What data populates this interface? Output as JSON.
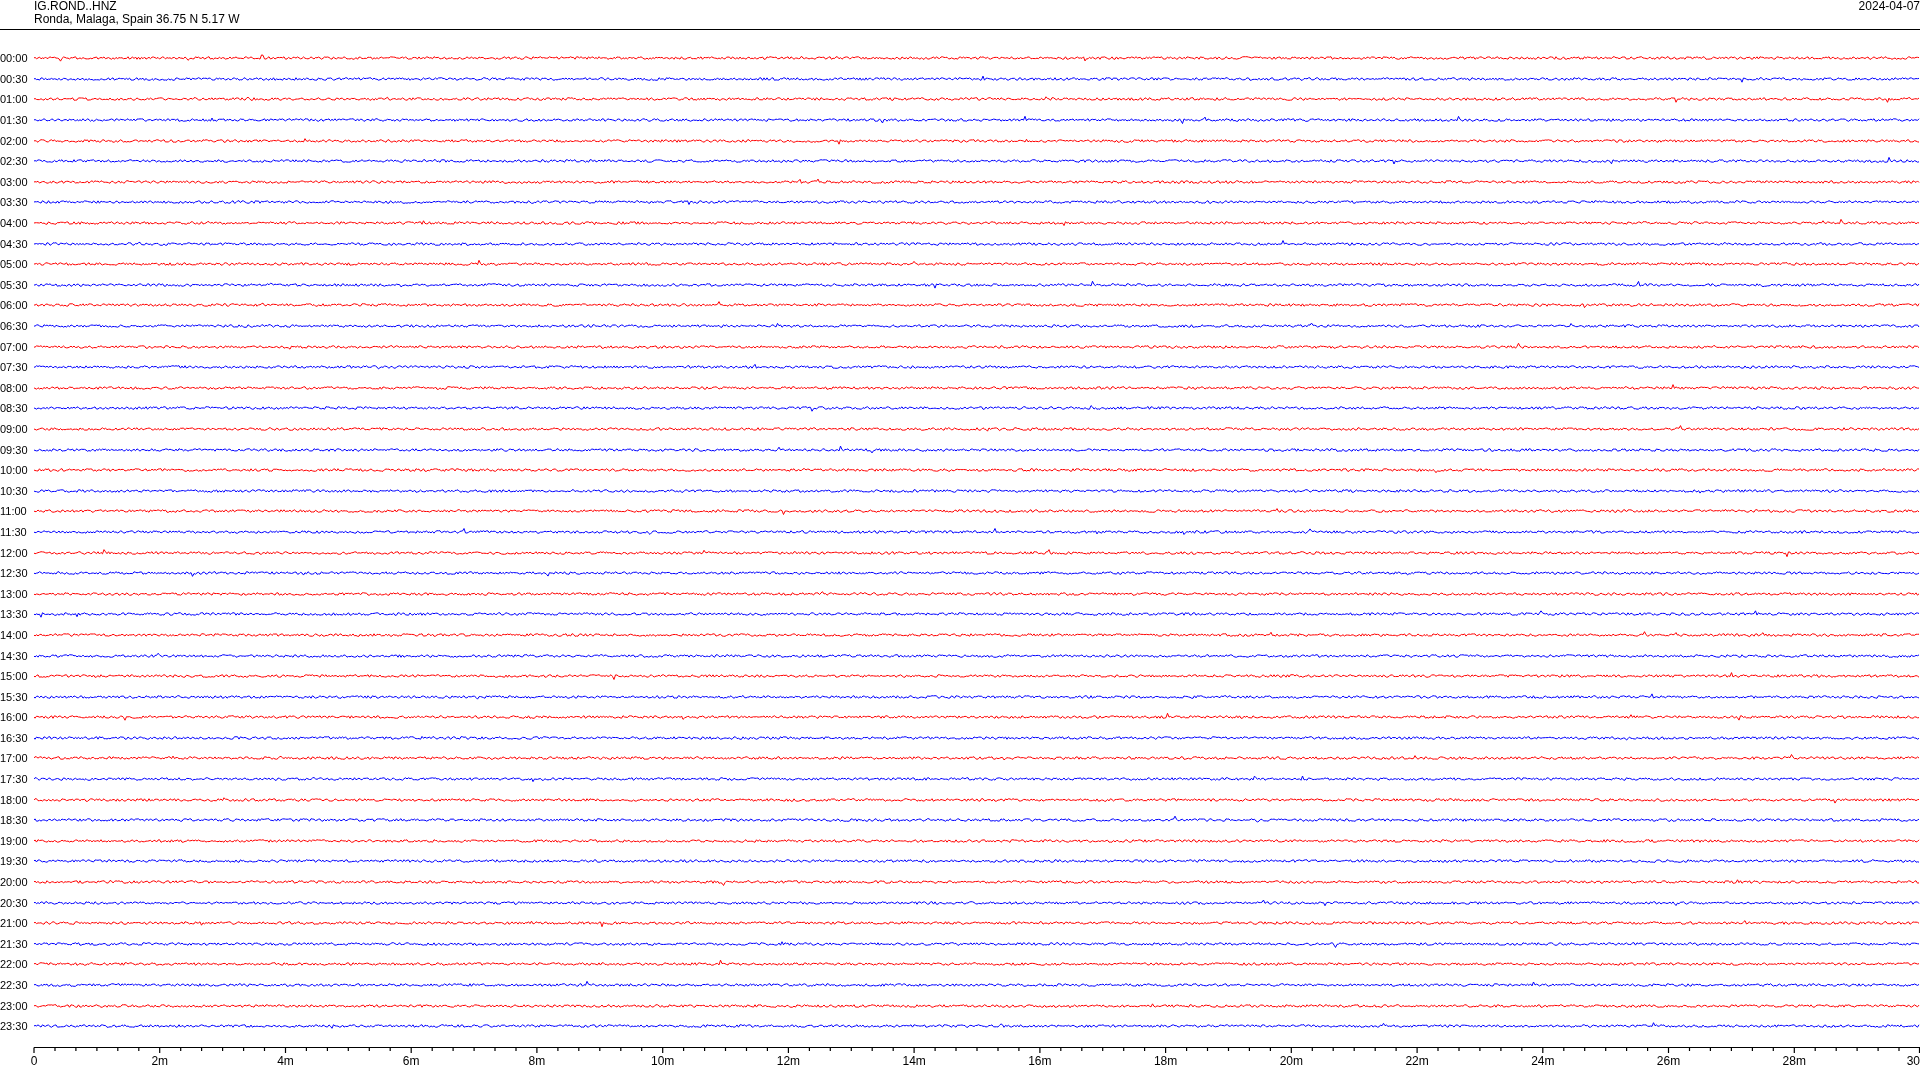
{
  "header": {
    "station": "IG.ROND..HNZ",
    "location": "Ronda, Malaga, Spain  36.75 N 5.17 W",
    "date": "2024-04-07"
  },
  "traces": [
    {
      "time": "00:00",
      "color": "#ff0000"
    },
    {
      "time": "00:30",
      "color": "#0000ff"
    },
    {
      "time": "01:00",
      "color": "#ff0000"
    },
    {
      "time": "01:30",
      "color": "#0000ff"
    },
    {
      "time": "02:00",
      "color": "#ff0000"
    },
    {
      "time": "02:30",
      "color": "#0000ff"
    },
    {
      "time": "03:00",
      "color": "#ff0000"
    },
    {
      "time": "03:30",
      "color": "#0000ff"
    },
    {
      "time": "04:00",
      "color": "#ff0000"
    },
    {
      "time": "04:30",
      "color": "#0000ff"
    },
    {
      "time": "05:00",
      "color": "#ff0000"
    },
    {
      "time": "05:30",
      "color": "#0000ff"
    },
    {
      "time": "06:00",
      "color": "#ff0000"
    },
    {
      "time": "06:30",
      "color": "#0000ff"
    },
    {
      "time": "07:00",
      "color": "#ff0000"
    },
    {
      "time": "07:30",
      "color": "#0000ff"
    },
    {
      "time": "08:00",
      "color": "#ff0000"
    },
    {
      "time": "08:30",
      "color": "#0000ff"
    },
    {
      "time": "09:00",
      "color": "#ff0000"
    },
    {
      "time": "09:30",
      "color": "#0000ff"
    },
    {
      "time": "10:00",
      "color": "#ff0000"
    },
    {
      "time": "10:30",
      "color": "#0000ff"
    },
    {
      "time": "11:00",
      "color": "#ff0000"
    },
    {
      "time": "11:30",
      "color": "#0000ff"
    },
    {
      "time": "12:00",
      "color": "#ff0000"
    },
    {
      "time": "12:30",
      "color": "#0000ff"
    },
    {
      "time": "13:00",
      "color": "#ff0000"
    },
    {
      "time": "13:30",
      "color": "#0000ff"
    },
    {
      "time": "14:00",
      "color": "#ff0000"
    },
    {
      "time": "14:30",
      "color": "#0000ff"
    },
    {
      "time": "15:00",
      "color": "#ff0000"
    },
    {
      "time": "15:30",
      "color": "#0000ff"
    },
    {
      "time": "16:00",
      "color": "#ff0000"
    },
    {
      "time": "16:30",
      "color": "#0000ff"
    },
    {
      "time": "17:00",
      "color": "#ff0000"
    },
    {
      "time": "17:30",
      "color": "#0000ff"
    },
    {
      "time": "18:00",
      "color": "#ff0000"
    },
    {
      "time": "18:30",
      "color": "#0000ff"
    },
    {
      "time": "19:00",
      "color": "#ff0000"
    },
    {
      "time": "19:30",
      "color": "#0000ff"
    },
    {
      "time": "20:00",
      "color": "#ff0000"
    },
    {
      "time": "20:30",
      "color": "#0000ff"
    },
    {
      "time": "21:00",
      "color": "#ff0000"
    },
    {
      "time": "21:30",
      "color": "#0000ff"
    },
    {
      "time": "22:00",
      "color": "#ff0000"
    },
    {
      "time": "22:30",
      "color": "#0000ff"
    },
    {
      "time": "23:00",
      "color": "#ff0000"
    },
    {
      "time": "23:30",
      "color": "#0000ff"
    }
  ],
  "axis": {
    "labels": [
      "0",
      "2m",
      "4m",
      "6m",
      "8m",
      "10m",
      "12m",
      "14m",
      "16m",
      "18m",
      "20m",
      "22m",
      "24m",
      "26m",
      "28m",
      "30"
    ]
  }
}
